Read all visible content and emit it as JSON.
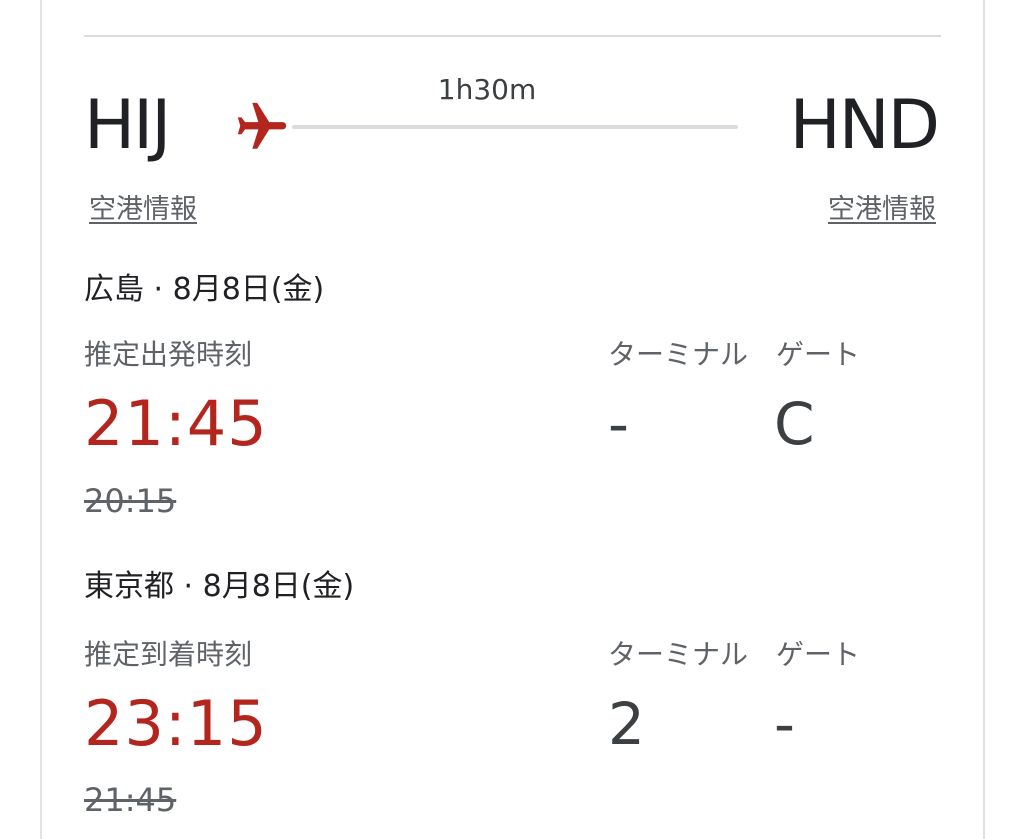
{
  "route": {
    "origin_code": "HIJ",
    "destination_code": "HND",
    "duration": "1h30m",
    "origin_info_link": "空港情報",
    "destination_info_link": "空港情報",
    "plane_icon": "airplane-icon",
    "accent_color": "#b3261e"
  },
  "departure": {
    "city_date": "広島 · 8月8日(金)",
    "time_label": "推定出発時刻",
    "estimated_time": "21:45",
    "scheduled_time": "20:15",
    "terminal_label": "ターミナル",
    "terminal_value": "-",
    "gate_label": "ゲート",
    "gate_value": "C"
  },
  "arrival": {
    "city_date": "東京都 · 8月8日(金)",
    "time_label": "推定到着時刻",
    "estimated_time": "23:15",
    "scheduled_time": "21:45",
    "terminal_label": "ターミナル",
    "terminal_value": "2",
    "gate_label": "ゲート",
    "gate_value": "-"
  }
}
